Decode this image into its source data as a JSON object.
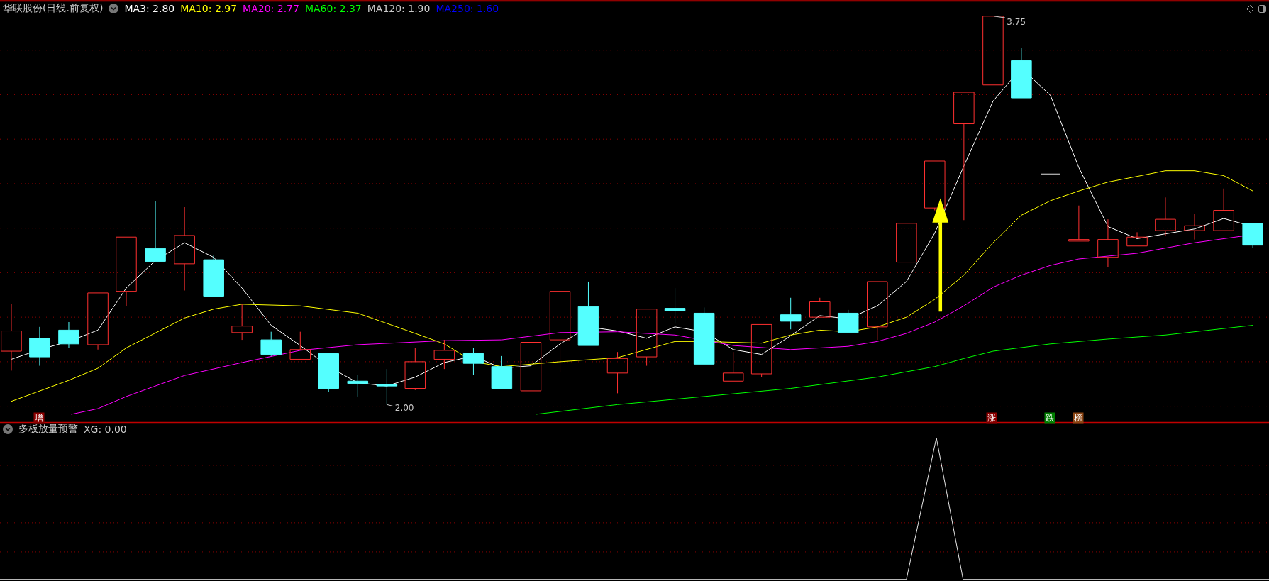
{
  "header": {
    "title": "华联股份(日线.前复权)",
    "legend": [
      {
        "label": "MA3: 2.80",
        "color": "#ffffff"
      },
      {
        "label": "MA10: 2.97",
        "color": "#ffff00"
      },
      {
        "label": "MA20: 2.77",
        "color": "#ff00ff"
      },
      {
        "label": "MA60: 2.37",
        "color": "#00ff00"
      },
      {
        "label": "MA120: 1.90",
        "color": "#c8c8c8"
      },
      {
        "label": "MA250: 1.60",
        "color": "#0000ff"
      }
    ]
  },
  "price_labels": [
    {
      "text": "3.75"
    },
    {
      "text": "2.00"
    }
  ],
  "signals": [
    {
      "text": "增",
      "color": "#8b0000"
    },
    {
      "text": "涨",
      "color": "#8b0000"
    },
    {
      "text": "跌",
      "color": "#008000"
    },
    {
      "text": "榜",
      "color": "#8b4513"
    }
  ],
  "indicator": {
    "title": "多板放量预警",
    "legend": "XG: 0.00"
  }
}
